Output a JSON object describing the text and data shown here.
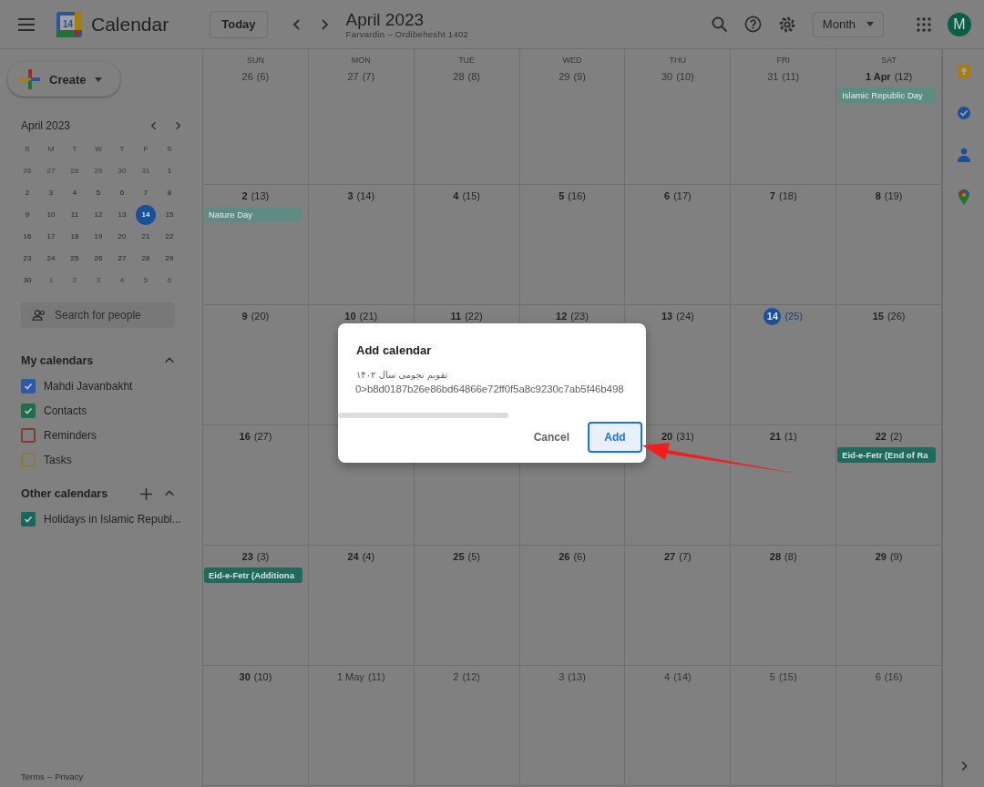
{
  "header": {
    "logo_day": "14",
    "app_name": "Calendar",
    "today_button": "Today",
    "title": "April 2023",
    "subtitle": "Farvardin – Ordibehesht 1402",
    "view_select": "Month",
    "avatar": "M"
  },
  "sidebar": {
    "create_button": "Create",
    "mini_calendar": {
      "title": "April 2023",
      "weekdays": [
        "S",
        "M",
        "T",
        "W",
        "T",
        "F",
        "S"
      ],
      "days": [
        {
          "d": "26",
          "current": false,
          "selected": false
        },
        {
          "d": "27",
          "current": false,
          "selected": false
        },
        {
          "d": "28",
          "current": false,
          "selected": false
        },
        {
          "d": "29",
          "current": false,
          "selected": false
        },
        {
          "d": "30",
          "current": false,
          "selected": false
        },
        {
          "d": "31",
          "current": false,
          "selected": false
        },
        {
          "d": "1",
          "current": true,
          "selected": false
        },
        {
          "d": "2",
          "current": true,
          "selected": false
        },
        {
          "d": "3",
          "current": true,
          "selected": false
        },
        {
          "d": "4",
          "current": true,
          "selected": false
        },
        {
          "d": "5",
          "current": true,
          "selected": false
        },
        {
          "d": "6",
          "current": true,
          "selected": false
        },
        {
          "d": "7",
          "current": true,
          "selected": false
        },
        {
          "d": "8",
          "current": true,
          "selected": false
        },
        {
          "d": "9",
          "current": true,
          "selected": false
        },
        {
          "d": "10",
          "current": true,
          "selected": false
        },
        {
          "d": "11",
          "current": true,
          "selected": false
        },
        {
          "d": "12",
          "current": true,
          "selected": false
        },
        {
          "d": "13",
          "current": true,
          "selected": false
        },
        {
          "d": "14",
          "current": true,
          "selected": true
        },
        {
          "d": "15",
          "current": true,
          "selected": false
        },
        {
          "d": "16",
          "current": true,
          "selected": false
        },
        {
          "d": "17",
          "current": true,
          "selected": false
        },
        {
          "d": "18",
          "current": true,
          "selected": false
        },
        {
          "d": "19",
          "current": true,
          "selected": false
        },
        {
          "d": "20",
          "current": true,
          "selected": false
        },
        {
          "d": "21",
          "current": true,
          "selected": false
        },
        {
          "d": "22",
          "current": true,
          "selected": false
        },
        {
          "d": "23",
          "current": true,
          "selected": false
        },
        {
          "d": "24",
          "current": true,
          "selected": false
        },
        {
          "d": "25",
          "current": true,
          "selected": false
        },
        {
          "d": "26",
          "current": true,
          "selected": false
        },
        {
          "d": "27",
          "current": true,
          "selected": false
        },
        {
          "d": "28",
          "current": true,
          "selected": false
        },
        {
          "d": "29",
          "current": true,
          "selected": false
        },
        {
          "d": "30",
          "current": true,
          "selected": false
        },
        {
          "d": "1",
          "current": false,
          "selected": false
        },
        {
          "d": "2",
          "current": false,
          "selected": false
        },
        {
          "d": "3",
          "current": false,
          "selected": false
        },
        {
          "d": "4",
          "current": false,
          "selected": false
        },
        {
          "d": "5",
          "current": false,
          "selected": false
        },
        {
          "d": "6",
          "current": false,
          "selected": false
        }
      ]
    },
    "search": {
      "placeholder": "Search for people"
    },
    "my_calendars": {
      "title": "My calendars",
      "items": [
        {
          "label": "Mahdi Javanbakht",
          "checked": true,
          "color": "#2d5aa8"
        },
        {
          "label": "Contacts",
          "checked": true,
          "color": "#1f6e4e"
        },
        {
          "label": "Reminders",
          "checked": false,
          "color": "#8a3a2e"
        },
        {
          "label": "Tasks",
          "checked": false,
          "color": "#867a3c"
        }
      ]
    },
    "other_calendars": {
      "title": "Other calendars",
      "items": [
        {
          "label": "Holidays in Islamic Republ...",
          "checked": true,
          "color": "#17685c"
        }
      ]
    },
    "footer": {
      "links": [
        "Terms",
        "Privacy"
      ],
      "separator": "–"
    }
  },
  "month": {
    "weekdays": [
      "SUN",
      "MON",
      "TUE",
      "WED",
      "THU",
      "FRI",
      "SAT"
    ],
    "weeks": [
      [
        {
          "kind": "day",
          "date": "26",
          "alt": "(6)",
          "current": false,
          "today": false
        },
        {
          "kind": "day",
          "date": "27",
          "alt": "(7)",
          "current": false,
          "today": false
        },
        {
          "kind": "day",
          "date": "28",
          "alt": "(8)",
          "current": false,
          "today": false
        },
        {
          "kind": "day",
          "date": "29",
          "alt": "(9)",
          "current": false,
          "today": false
        },
        {
          "kind": "day",
          "date": "30",
          "alt": "(10)",
          "current": false,
          "today": false
        },
        {
          "kind": "day",
          "date": "31",
          "alt": "(11)",
          "current": false,
          "today": false
        },
        {
          "kind": "day",
          "date": "1 Apr",
          "alt": "(12)",
          "current": true,
          "today": false,
          "events": [
            {
              "label": "Islamic Republic Day",
              "past": true
            }
          ]
        }
      ],
      [
        {
          "kind": "day",
          "date": "2",
          "alt": "(13)",
          "current": true,
          "today": false,
          "events": [
            {
              "label": "Nature Day",
              "past": true
            }
          ]
        },
        {
          "kind": "day",
          "date": "3",
          "alt": "(14)",
          "current": true,
          "today": false
        },
        {
          "kind": "day",
          "date": "4",
          "alt": "(15)",
          "current": true,
          "today": false
        },
        {
          "kind": "day",
          "date": "5",
          "alt": "(16)",
          "current": true,
          "today": false
        },
        {
          "kind": "day",
          "date": "6",
          "alt": "(17)",
          "current": true,
          "today": false
        },
        {
          "kind": "day",
          "date": "7",
          "alt": "(18)",
          "current": true,
          "today": false
        },
        {
          "kind": "day",
          "date": "8",
          "alt": "(19)",
          "current": true,
          "today": false
        }
      ],
      [
        {
          "kind": "day",
          "date": "9",
          "alt": "(20)",
          "current": true,
          "today": false
        },
        {
          "kind": "day",
          "date": "10",
          "alt": "(21)",
          "current": true,
          "today": false
        },
        {
          "kind": "day",
          "date": "11",
          "alt": "(22)",
          "current": true,
          "today": false
        },
        {
          "kind": "day",
          "date": "12",
          "alt": "(23)",
          "current": true,
          "today": false
        },
        {
          "kind": "day",
          "date": "13",
          "alt": "(24)",
          "current": true,
          "today": false
        },
        {
          "kind": "day",
          "date": "14",
          "alt": "(25)",
          "current": true,
          "today": true
        },
        {
          "kind": "day",
          "date": "15",
          "alt": "(26)",
          "current": true,
          "today": false
        }
      ],
      [
        {
          "kind": "day",
          "date": "16",
          "alt": "(27)",
          "current": true,
          "today": false
        },
        {
          "kind": "covered"
        },
        {
          "kind": "covered"
        },
        {
          "kind": "covered"
        },
        {
          "kind": "day",
          "date": "20",
          "alt": "(31)",
          "current": true,
          "today": false
        },
        {
          "kind": "day",
          "date": "21",
          "alt": "(1)",
          "current": true,
          "today": false
        },
        {
          "kind": "day",
          "date": "22",
          "alt": "(2)",
          "current": true,
          "today": false,
          "events": [
            {
              "label": "Eid-e-Fetr (End of Ra",
              "past": false
            }
          ]
        }
      ],
      [
        {
          "kind": "day",
          "date": "23",
          "alt": "(3)",
          "current": true,
          "today": false,
          "events": [
            {
              "label": "Eid-e-Fetr (Additiona",
              "past": false
            }
          ]
        },
        {
          "kind": "day",
          "date": "24",
          "alt": "(4)",
          "current": true,
          "today": false
        },
        {
          "kind": "day",
          "date": "25",
          "alt": "(5)",
          "current": true,
          "today": false
        },
        {
          "kind": "day",
          "date": "26",
          "alt": "(6)",
          "current": true,
          "today": false
        },
        {
          "kind": "day",
          "date": "27",
          "alt": "(7)",
          "current": true,
          "today": false
        },
        {
          "kind": "day",
          "date": "28",
          "alt": "(8)",
          "current": true,
          "today": false
        },
        {
          "kind": "day",
          "date": "29",
          "alt": "(9)",
          "current": true,
          "today": false
        }
      ],
      [
        {
          "kind": "day",
          "date": "30",
          "alt": "(10)",
          "current": true,
          "today": false
        },
        {
          "kind": "day",
          "date": "1 May",
          "alt": "(11)",
          "current": false,
          "today": false
        },
        {
          "kind": "day",
          "date": "2",
          "alt": "(12)",
          "current": false,
          "today": false
        },
        {
          "kind": "day",
          "date": "3",
          "alt": "(13)",
          "current": false,
          "today": false
        },
        {
          "kind": "day",
          "date": "4",
          "alt": "(14)",
          "current": false,
          "today": false
        },
        {
          "kind": "day",
          "date": "5",
          "alt": "(15)",
          "current": false,
          "today": false
        },
        {
          "kind": "day",
          "date": "6",
          "alt": "(16)",
          "current": false,
          "today": false
        }
      ]
    ]
  },
  "dialog": {
    "title": "Add calendar",
    "calendar_name": "تقویم نجومی سال ۱۴۰۲",
    "calendar_id": "0>b8d0187b26e86bd64866e72ff0f5a8c9230c7ab5f46b498",
    "buttons": [
      {
        "label": "Cancel",
        "kind": "text"
      },
      {
        "label": "Add",
        "kind": "primary"
      }
    ]
  }
}
